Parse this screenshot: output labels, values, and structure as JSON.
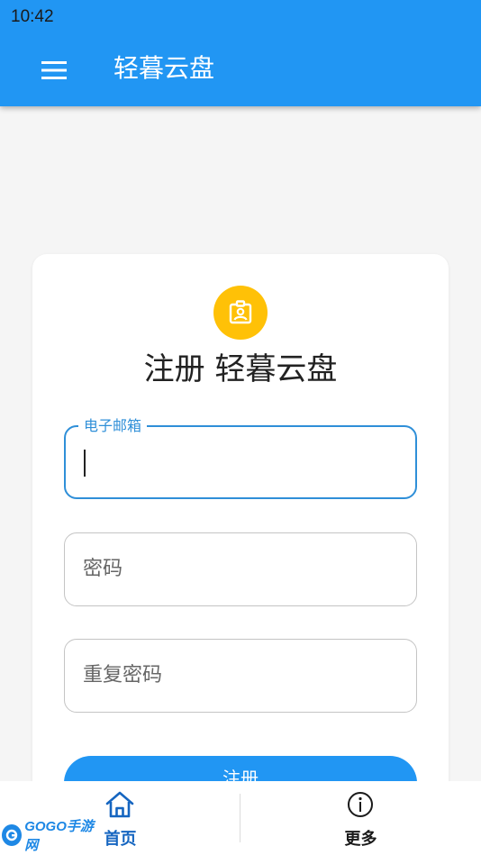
{
  "status_bar": {
    "time": "10:42"
  },
  "appbar": {
    "title": "轻暮云盘",
    "menu_icon": "menu-icon"
  },
  "card": {
    "avatar_icon": "contact-badge-icon",
    "title": "注册 轻暮云盘",
    "email": {
      "label": "电子邮箱",
      "value": ""
    },
    "password": {
      "placeholder": "密码"
    },
    "confirm_password": {
      "placeholder": "重复密码"
    },
    "submit_label": "注册"
  },
  "bottom_nav": {
    "items": [
      {
        "label": "首页",
        "icon": "home-icon",
        "active": true
      },
      {
        "label": "更多",
        "icon": "info-icon",
        "active": false
      }
    ]
  },
  "watermark": {
    "text": "GOGO手游网"
  },
  "colors": {
    "primary": "#2196f3",
    "accent": "#ffc107",
    "focus": "#2f8fd8"
  }
}
